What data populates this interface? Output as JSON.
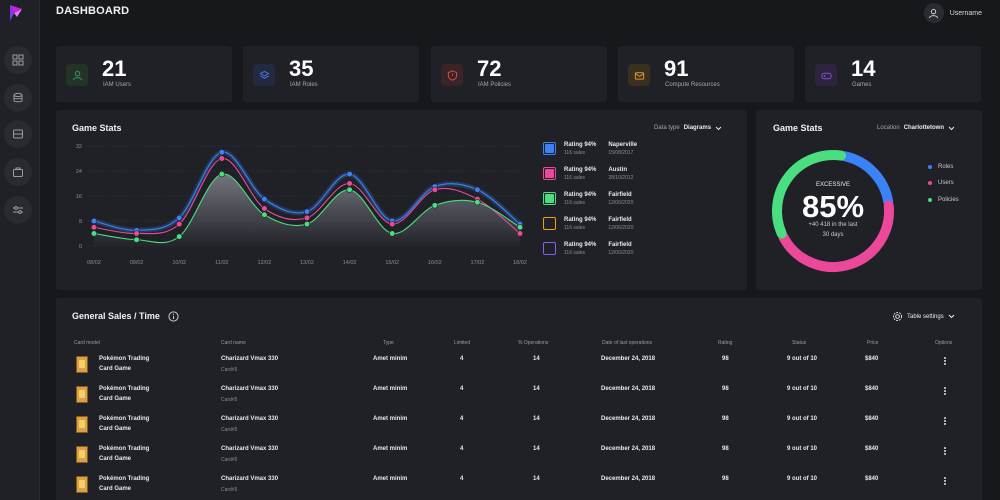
{
  "header": {
    "title": "DASHBOARD",
    "username": "Username"
  },
  "sidebar": {
    "items": [
      "grid-icon",
      "database-icon",
      "server-icon",
      "briefcase-icon",
      "sliders-icon"
    ]
  },
  "stats": [
    {
      "value": "21",
      "label": "IAM Users",
      "color": "#3a8c5a",
      "bg": "#233328",
      "icon": "user-icon"
    },
    {
      "value": "35",
      "label": "IAM Roles",
      "color": "#4a6fd8",
      "bg": "#232a40",
      "icon": "layers-icon"
    },
    {
      "value": "72",
      "label": "IAM Policies",
      "color": "#d84a4a",
      "bg": "#3a2428",
      "icon": "shield-icon"
    },
    {
      "value": "91",
      "label": "Compute Resources",
      "color": "#d8962a",
      "bg": "#3a3020",
      "icon": "mail-icon"
    },
    {
      "value": "14",
      "label": "Games",
      "color": "#8a4ad8",
      "bg": "#2e2440",
      "icon": "gamepad-icon"
    }
  ],
  "game_stats": {
    "title": "Game Stats",
    "data_type_label": "Data type",
    "data_type_value": "Diagrams",
    "legend": [
      {
        "rating": "Rating 94%",
        "sales": "116 sales",
        "city": "Naperville",
        "date": "15/08/2017",
        "color": "#3b82f6",
        "checked": true
      },
      {
        "rating": "Rating 94%",
        "sales": "116 sales",
        "city": "Austin",
        "date": "28/10/2012",
        "color": "#ec4899",
        "checked": true
      },
      {
        "rating": "Rating 94%",
        "sales": "116 sales",
        "city": "Fairfield",
        "date": "12/06/2020",
        "color": "#4ade80",
        "checked": true
      },
      {
        "rating": "Rating 94%",
        "sales": "116 sales",
        "city": "Fairfield",
        "date": "12/06/2020",
        "color": "#f59e0b",
        "checked": false
      },
      {
        "rating": "Rating 94%",
        "sales": "116 sales",
        "city": "Fairfield",
        "date": "12/06/2020",
        "color": "#8b5cf6",
        "checked": false
      }
    ]
  },
  "chart_data": {
    "type": "line",
    "x": [
      "08/02",
      "09/02",
      "10/02",
      "11/02",
      "12/02",
      "13/02",
      "14/02",
      "15/02",
      "16/02",
      "17/02",
      "18/02"
    ],
    "ylim": [
      0,
      32
    ],
    "yticks": [
      "0",
      "8",
      "16",
      "24",
      "32"
    ],
    "grid": true,
    "series": [
      {
        "color": "#3b82f6",
        "values": [
          8,
          5,
          9,
          30,
          15,
          11,
          23,
          8,
          19,
          18,
          7
        ]
      },
      {
        "color": "#ec4899",
        "values": [
          6,
          4,
          7,
          28,
          12,
          9,
          20,
          7,
          18,
          15,
          4
        ]
      },
      {
        "color": "#4ade80",
        "values": [
          4,
          2,
          3,
          23,
          10,
          7,
          18,
          4,
          13,
          14,
          6
        ]
      }
    ]
  },
  "game_stats_2": {
    "title": "Game Stats",
    "location_label": "Location",
    "location_value": "Charlottetown",
    "gauge_status": "EXCESSIVE",
    "gauge_percent": "85%",
    "gauge_note_1": "+40 418 in the last",
    "gauge_note_2": "30 days",
    "segments": [
      {
        "name": "Roles",
        "color": "#3b82f6",
        "fraction": 0.2
      },
      {
        "name": "Users",
        "color": "#ec4899",
        "fraction": 0.45
      },
      {
        "name": "Policies",
        "color": "#4ade80",
        "fraction": 0.35
      }
    ]
  },
  "sales": {
    "title": "General Sales / Time",
    "table_settings": "Table settings",
    "columns": [
      "Card model",
      "Card name",
      "Type",
      "Limited",
      "% Operations",
      "Date of last operations",
      "Rating",
      "Status",
      "Price",
      "Options"
    ],
    "rows": [
      {
        "model": [
          "Pokémon Trading",
          "Card Game"
        ],
        "name": "Charizard Vmax 330",
        "sub": "Card#5",
        "type": "Amet minim",
        "limited": "4",
        "ops": "14",
        "date": "December 24, 2018",
        "rating": "98",
        "status": "9 out of 10",
        "price": "$840"
      },
      {
        "model": [
          "Pokémon Trading",
          "Card Game"
        ],
        "name": "Charizard Vmax 330",
        "sub": "Card#5",
        "type": "Amet minim",
        "limited": "4",
        "ops": "14",
        "date": "December 24, 2018",
        "rating": "98",
        "status": "9 out of 10",
        "price": "$840"
      },
      {
        "model": [
          "Pokémon Trading",
          "Card Game"
        ],
        "name": "Charizard Vmax 330",
        "sub": "Card#5",
        "type": "Amet minim",
        "limited": "4",
        "ops": "14",
        "date": "December 24, 2018",
        "rating": "98",
        "status": "9 out of 10",
        "price": "$840"
      },
      {
        "model": [
          "Pokémon Trading",
          "Card Game"
        ],
        "name": "Charizard Vmax 330",
        "sub": "Card#5",
        "type": "Amet minim",
        "limited": "4",
        "ops": "14",
        "date": "December 24, 2018",
        "rating": "98",
        "status": "9 out of 10",
        "price": "$840"
      },
      {
        "model": [
          "Pokémon Trading",
          "Card Game"
        ],
        "name": "Charizard Vmax 330",
        "sub": "Card#5",
        "type": "Amet minim",
        "limited": "4",
        "ops": "14",
        "date": "December 24, 2018",
        "rating": "98",
        "status": "9 out of 10",
        "price": "$840"
      }
    ]
  }
}
